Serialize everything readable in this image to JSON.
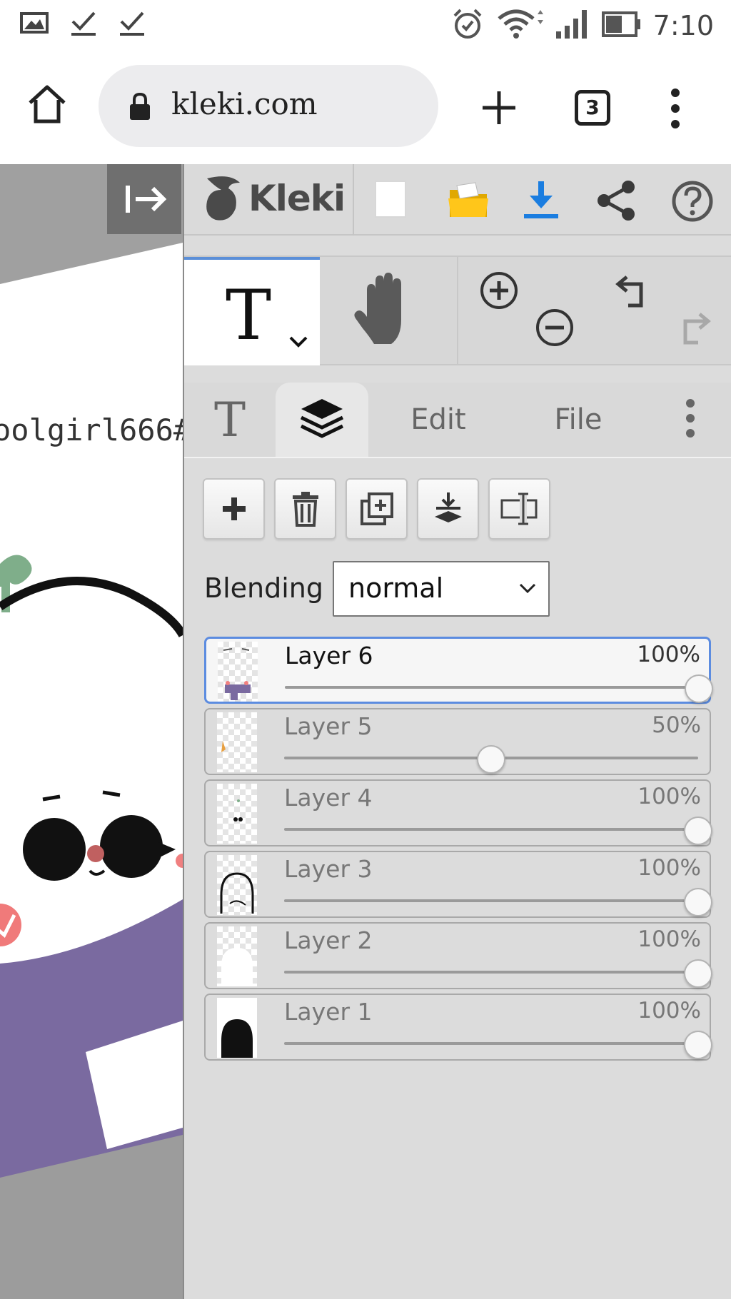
{
  "status_bar": {
    "time": "7:10",
    "icons": [
      "gallery-icon",
      "check-icon",
      "check-icon",
      "alarm-icon",
      "wifi-icon",
      "signal-icon",
      "battery-icon"
    ]
  },
  "browser": {
    "url": "kleki.com",
    "tab_count": "3",
    "icons": [
      "home-icon",
      "lock-icon",
      "plus-icon",
      "tab-count-icon",
      "overflow-menu-icon"
    ]
  },
  "canvas": {
    "visible_text": "oolgirl666#",
    "colors": {
      "sweater": "#7a6aa0",
      "leaf": "#7fae8a",
      "blush": "#f08080"
    }
  },
  "app": {
    "logo_text": "Kleki",
    "accent_color": "#5b8fd8",
    "toolbar_icons": [
      "new-image-icon",
      "open-folder-icon",
      "download-icon",
      "share-icon",
      "help-icon"
    ],
    "tool_icons": [
      "text-tool-icon",
      "hand-tool-icon",
      "zoom-in-icon",
      "zoom-out-icon",
      "undo-icon",
      "redo-icon"
    ],
    "tabs": [
      {
        "label": "T",
        "icon": "text-tab-icon",
        "active": false
      },
      {
        "label": "",
        "icon": "layers-tab-icon",
        "active": true
      },
      {
        "label": "Edit",
        "active": false
      },
      {
        "label": "File",
        "active": false
      },
      {
        "label": "",
        "icon": "more-icon",
        "active": false
      }
    ]
  },
  "layers_panel": {
    "tool_buttons": [
      "add-layer-icon",
      "delete-layer-icon",
      "duplicate-layer-icon",
      "merge-down-icon",
      "rename-layer-icon"
    ],
    "blending_label": "Blending",
    "blending_value": "normal",
    "layers": [
      {
        "name": "Layer 6",
        "opacity": "100%",
        "opacity_value": 1.0,
        "selected": true
      },
      {
        "name": "Layer 5",
        "opacity": "50%",
        "opacity_value": 0.5,
        "selected": false
      },
      {
        "name": "Layer 4",
        "opacity": "100%",
        "opacity_value": 1.0,
        "selected": false
      },
      {
        "name": "Layer 3",
        "opacity": "100%",
        "opacity_value": 1.0,
        "selected": false
      },
      {
        "name": "Layer 2",
        "opacity": "100%",
        "opacity_value": 1.0,
        "selected": false
      },
      {
        "name": "Layer 1",
        "opacity": "100%",
        "opacity_value": 1.0,
        "selected": false
      }
    ]
  }
}
